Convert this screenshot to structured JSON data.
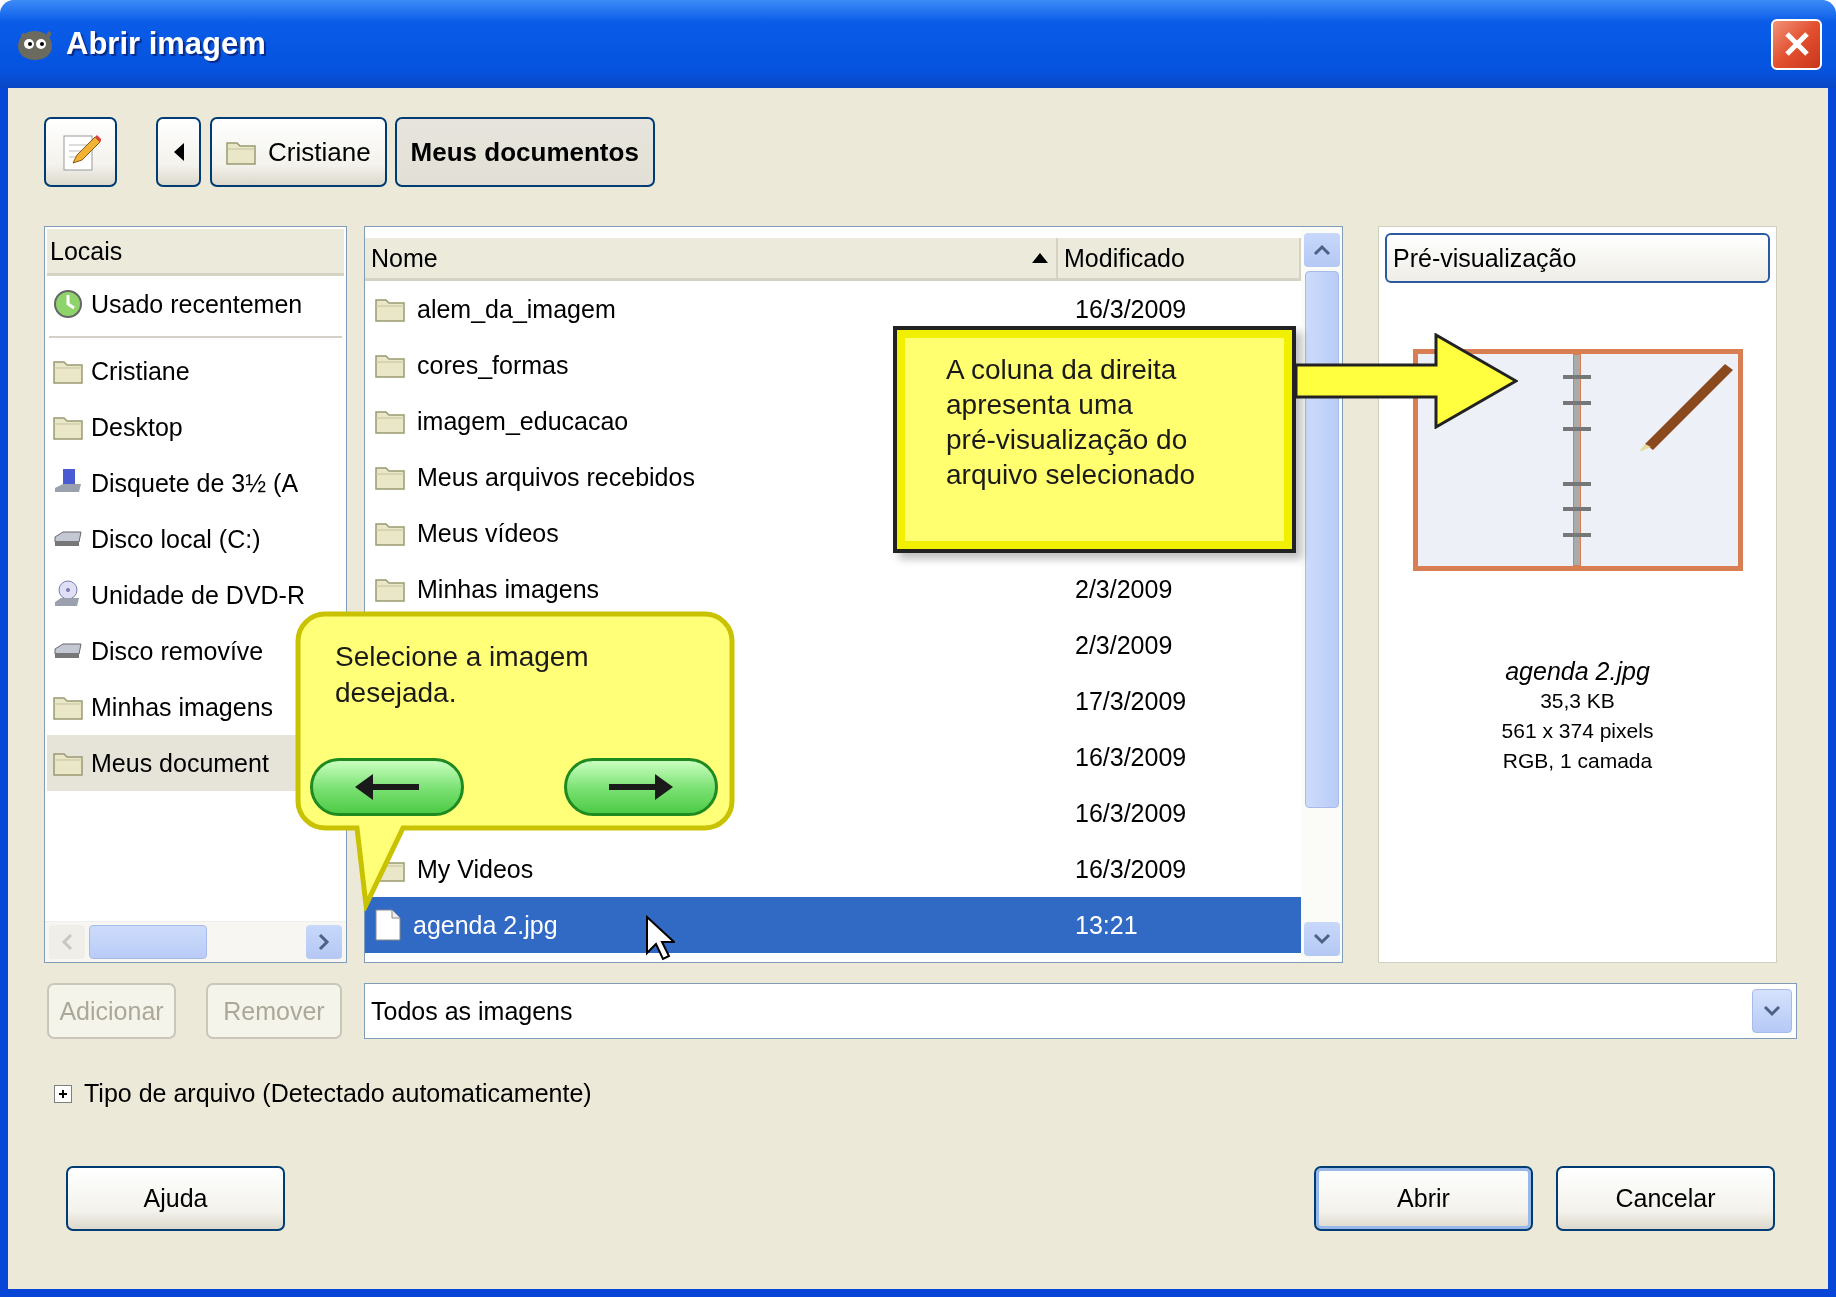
{
  "window": {
    "title": "Abrir imagem"
  },
  "toolbar": {
    "path": [
      {
        "label": "Cristiane",
        "selected": false
      },
      {
        "label": "Meus documentos",
        "selected": true
      }
    ]
  },
  "places": {
    "header": "Locais",
    "items": [
      {
        "label": "Usado recentemen",
        "kind": "recent",
        "selected": false
      },
      {
        "label": "Cristiane",
        "kind": "folder",
        "selected": false
      },
      {
        "label": "Desktop",
        "kind": "folder",
        "selected": false
      },
      {
        "label": "Disquete de 3½ (A",
        "kind": "floppy",
        "selected": false
      },
      {
        "label": "Disco local (C:)",
        "kind": "drive",
        "selected": false
      },
      {
        "label": "Unidade de DVD-R",
        "kind": "dvd",
        "selected": false
      },
      {
        "label": "Disco removíve",
        "kind": "drive",
        "selected": false
      },
      {
        "label": "Minhas imagens",
        "kind": "folder",
        "selected": false
      },
      {
        "label": "Meus document",
        "kind": "folder",
        "selected": true
      }
    ]
  },
  "files": {
    "columns": [
      {
        "label": "Nome",
        "sorted": true
      },
      {
        "label": "Modificado"
      }
    ],
    "rows": [
      {
        "name": "alem_da_imagem",
        "kind": "folder",
        "modified": "16/3/2009",
        "selected": false
      },
      {
        "name": "cores_formas",
        "kind": "folder",
        "selected": false
      },
      {
        "name": "imagem_educacao",
        "kind": "folder",
        "selected": false
      },
      {
        "name": "Meus arquivos recebidos",
        "kind": "folder",
        "selected": false
      },
      {
        "name": "Meus vídeos",
        "kind": "folder",
        "selected": false
      },
      {
        "name": "Minhas imagens",
        "kind": "folder",
        "modified": "2/3/2009",
        "selected": false
      },
      {
        "modified": "2/3/2009",
        "selected": false
      },
      {
        "modified": "17/3/2009",
        "selected": false
      },
      {
        "modified": "16/3/2009",
        "selected": false
      },
      {
        "modified": "16/3/2009",
        "selected": false
      },
      {
        "name": "My Videos",
        "kind": "folder",
        "modified": "16/3/2009",
        "selected": false
      },
      {
        "name": "agenda 2.jpg",
        "kind": "file",
        "modified": "13:21",
        "selected": true
      }
    ]
  },
  "preview": {
    "header": "Pré-visualização",
    "file_name": "agenda 2.jpg",
    "details": [
      "35,3 KB",
      "561 x 374 pixels",
      "RGB, 1 camada"
    ]
  },
  "place_buttons": [
    {
      "label": "Adicionar",
      "disabled": true
    },
    {
      "label": "Remover",
      "disabled": true
    }
  ],
  "filter": {
    "value": "Todos as imagens"
  },
  "file_type": {
    "label": "Tipo de arquivo (Detectado automaticamente)",
    "expanded": false
  },
  "buttons": [
    {
      "label": "Ajuda",
      "default": false
    },
    {
      "label": "Abrir",
      "default": true
    },
    {
      "label": "Cancelar",
      "default": false
    }
  ],
  "callouts": [
    {
      "kind": "bubble",
      "text": "Selecione a imagem desejada."
    },
    {
      "kind": "arrow-box",
      "text": "A coluna da direita\napresenta uma\npré-visualização do\narquivo selecionado"
    }
  ]
}
